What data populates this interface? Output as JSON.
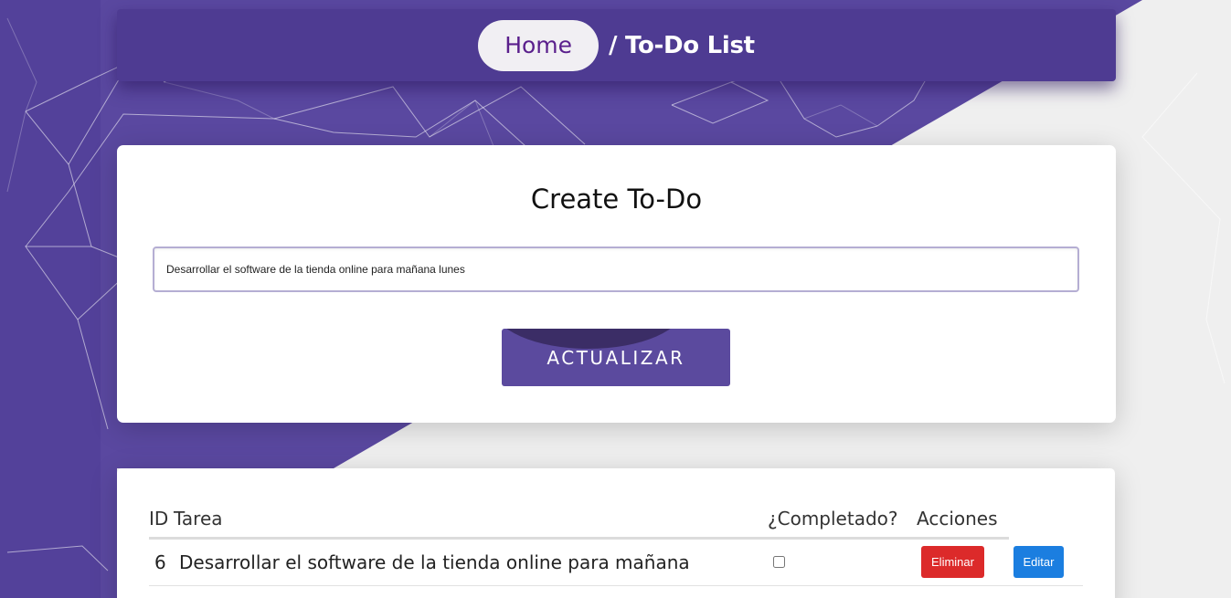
{
  "colors": {
    "brand_purple": "#5b4a9e",
    "header_purple": "#4e3b92",
    "danger": "#dc2a2a",
    "primary": "#1b7ee0"
  },
  "breadcrumb": {
    "home_label": "Home",
    "current_label": "/ To-Do List"
  },
  "create_form": {
    "title": "Create To-Do",
    "input_value": "Desarrollar el software de la tienda online para mañana lunes",
    "submit_label": "ACTUALIZAR"
  },
  "table": {
    "headers": {
      "id": "ID",
      "task": "Tarea",
      "completed": "¿Completado?",
      "actions": "Acciones"
    },
    "rows": [
      {
        "id": "6",
        "task": "Desarrollar el software de la tienda online para mañana",
        "completed": false,
        "delete_label": "Eliminar",
        "edit_label": "Editar"
      }
    ]
  }
}
